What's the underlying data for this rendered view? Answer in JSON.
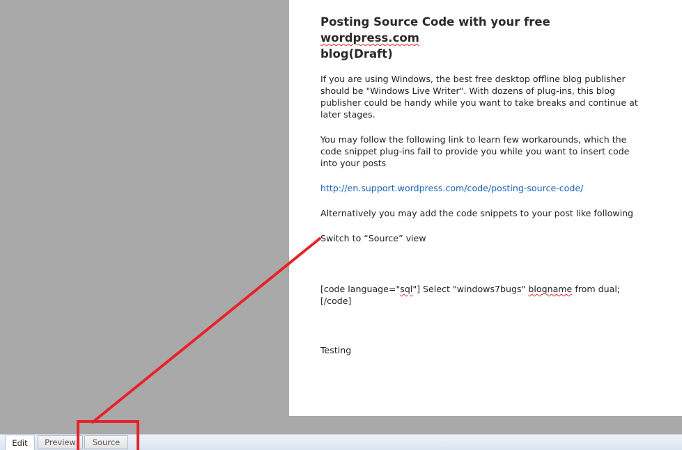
{
  "post": {
    "title_line1_pre": "Posting Source Code with your free ",
    "title_line1_flagged": "wordpress.com",
    "title_line2": "blog(Draft)",
    "para1": "If you are using Windows, the best free desktop offline blog publisher should be \"Windows Live Writer\". With dozens of plug-ins, this blog publisher could be handy while you want to take breaks and continue at later stages.",
    "para2": "You may follow the following link to learn few workarounds, which the code snippet plug-ins fail to provide you while you want to insert code into your posts",
    "link_url": "http://en.support.wordpress.com/code/posting-source-code/",
    "para4": "Alternatively you may add the code snippets to your post like following",
    "para5": "Switch to “Source” view",
    "code_pre": "[code language=\"",
    "code_lang": "sql",
    "code_mid": "\"] Select \"windows7bugs\" ",
    "code_flagged": "blogname",
    "code_post": " from dual; [/code]",
    "para7": "Testing"
  },
  "view_tabs": {
    "edit": "Edit",
    "preview": "Preview",
    "source": "Source",
    "active": "edit"
  },
  "annotation": {
    "color": "#e8222a",
    "target_tab": "source"
  },
  "colors": {
    "workspace_bg": "#a9a9a9",
    "document_bg": "#ffffff",
    "link": "#1a62b5",
    "spellcheck_underline": "#e0272e"
  }
}
